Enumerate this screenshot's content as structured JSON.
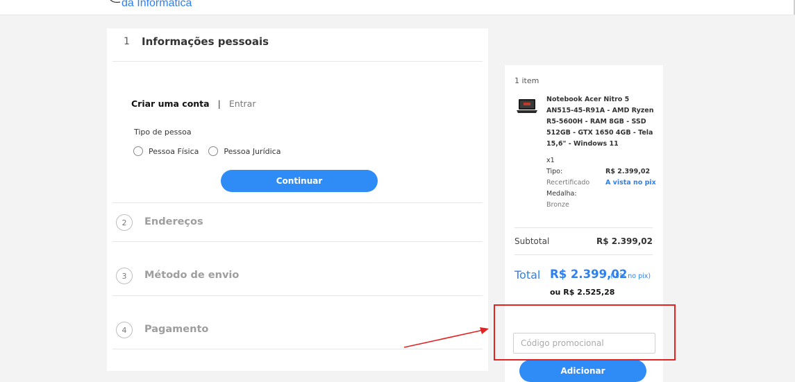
{
  "header": {
    "logo_text": "da Informática"
  },
  "checkout": {
    "step1": {
      "number": "1",
      "title": "Informações pessoais"
    },
    "auth_tabs": {
      "create": "Criar uma conta",
      "separator": "|",
      "login": "Entrar"
    },
    "person_type_label": "Tipo de pessoa",
    "person_types": [
      "Pessoa Física",
      "Pessoa Jurídica"
    ],
    "continue_label": "Continuar",
    "steps": [
      {
        "number": "2",
        "title": "Endereços"
      },
      {
        "number": "3",
        "title": "Método de envio"
      },
      {
        "number": "4",
        "title": "Pagamento"
      }
    ]
  },
  "summary": {
    "items_count": "1 item",
    "product": {
      "name": "Notebook Acer Nitro 5 AN515-45-R91A - AMD Ryzen R5-5600H - RAM 8GB - SSD 512GB - GTX 1650 4GB - Tela 15,6\" - Windows 11",
      "qty": "x1",
      "type_label": "Tipo:",
      "type_value": "Recertificado",
      "medal_label": "Medalha:",
      "medal_value": "Bronze",
      "price": "R$ 2.399,02",
      "pix_note": "A vista no pix"
    },
    "subtotal_label": "Subtotal",
    "subtotal_value": "R$ 2.399,02",
    "total_label": "Total",
    "total_value": "R$ 2.399,02",
    "total_note": "(-5% no pix)",
    "alt_price": "ou R$ 2.525,28",
    "promo_placeholder": "Código promocional",
    "add_label": "Adicionar"
  },
  "colors": {
    "accent": "#2f8bf5",
    "link": "#2f80ed",
    "annotation": "#e52222"
  }
}
